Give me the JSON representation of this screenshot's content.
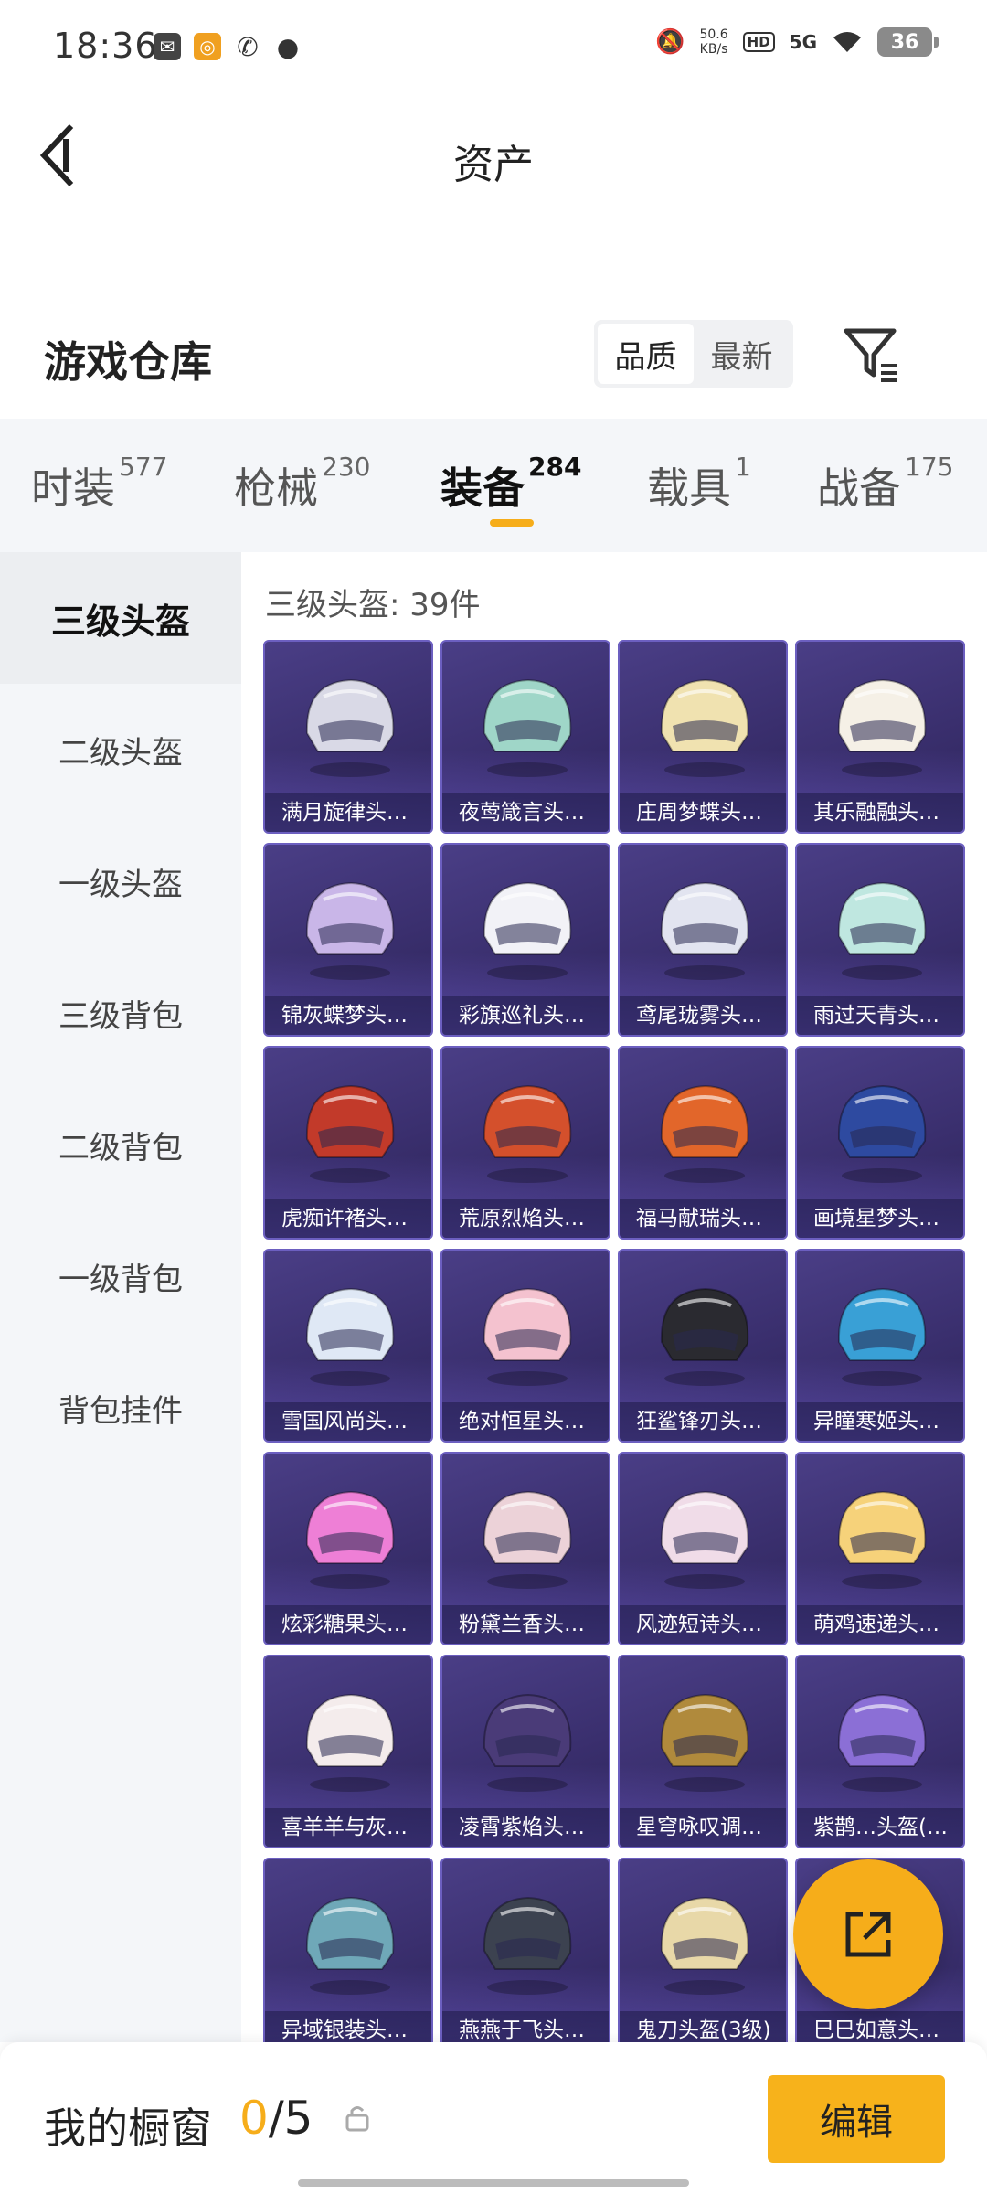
{
  "status_bar": {
    "time": "18:36",
    "net_speed": "50.6",
    "net_unit": "KB/s",
    "hd": "HD",
    "signal": "5G",
    "battery": "36"
  },
  "header": {
    "title": "资产"
  },
  "warehouse": {
    "title": "游戏仓库",
    "sort_quality": "品质",
    "sort_latest": "最新"
  },
  "tabs": [
    {
      "label": "时装",
      "count": "577"
    },
    {
      "label": "枪械",
      "count": "230"
    },
    {
      "label": "装备",
      "count": "284"
    },
    {
      "label": "载具",
      "count": "1"
    },
    {
      "label": "战备",
      "count": "175"
    }
  ],
  "sidebar": [
    {
      "label": "三级头盔"
    },
    {
      "label": "二级头盔"
    },
    {
      "label": "一级头盔"
    },
    {
      "label": "三级背包"
    },
    {
      "label": "二级背包"
    },
    {
      "label": "一级背包"
    },
    {
      "label": "背包挂件"
    }
  ],
  "content": {
    "count_label": "三级头盔: 39件"
  },
  "items": [
    {
      "name": "满月旋律头…",
      "color": "#d9d9e6"
    },
    {
      "name": "夜莺箴言头…",
      "color": "#9fd6c8"
    },
    {
      "name": "庄周梦蝶头…",
      "color": "#f0e2b0"
    },
    {
      "name": "其乐融融头…",
      "color": "#f5f0e6"
    },
    {
      "name": "锦灰蝶梦头…",
      "color": "#c9b6e8"
    },
    {
      "name": "彩旗巡礼头…",
      "color": "#f2f2f7"
    },
    {
      "name": "鸢尾珑雾头…",
      "color": "#e2e4f0"
    },
    {
      "name": "雨过天青头…",
      "color": "#bfe7e0"
    },
    {
      "name": "虎痴许褚头…",
      "color": "#c23a2a"
    },
    {
      "name": "荒原烈焰头…",
      "color": "#d4502c"
    },
    {
      "name": "福马献瑞头…",
      "color": "#e2662a"
    },
    {
      "name": "画境星梦头…",
      "color": "#2e4aa0"
    },
    {
      "name": "雪国风尚头…",
      "color": "#dfe8f5"
    },
    {
      "name": "绝对恒星头…",
      "color": "#f4c2cf"
    },
    {
      "name": "狂鲨锋刃头…",
      "color": "#2a2a30"
    },
    {
      "name": "异瞳寒姬头…",
      "color": "#39a0d6"
    },
    {
      "name": "炫彩糖果头…",
      "color": "#ee7fd6"
    },
    {
      "name": "粉黛兰香头…",
      "color": "#ecd2d8"
    },
    {
      "name": "风迹短诗头…",
      "color": "#f0dce8"
    },
    {
      "name": "萌鸡速递头…",
      "color": "#f6d27a"
    },
    {
      "name": "喜羊羊与灰…",
      "color": "#f4ecec"
    },
    {
      "name": "凌霄紫焰头…",
      "color": "#4a3b78"
    },
    {
      "name": "星穹咏叹调…",
      "color": "#b08a3c"
    },
    {
      "name": "紫鹊…头盔(…",
      "color": "#8b6fd6"
    },
    {
      "name": "异域银装头…",
      "color": "#6fa8b8"
    },
    {
      "name": "燕燕于飞头…",
      "color": "#3c4250"
    },
    {
      "name": "鬼刀头盔(3级)",
      "color": "#e8d8a8"
    },
    {
      "name": "巳巳如意头…",
      "color": "#f0d6c8"
    }
  ],
  "bottom": {
    "my_window": "我的橱窗",
    "used": "0",
    "total": "/5",
    "edit": "编辑"
  },
  "accent_color": "#f6ad1a"
}
